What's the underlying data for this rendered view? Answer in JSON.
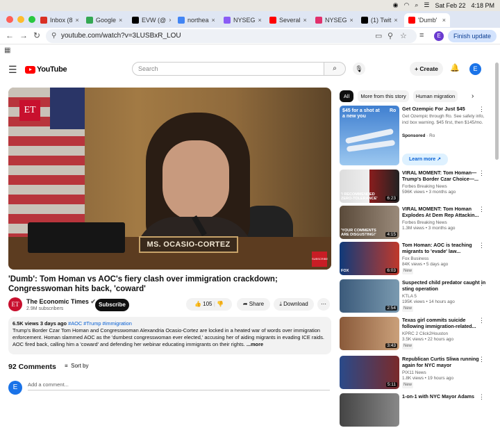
{
  "os": {
    "date": "Sat Feb 22",
    "time": "4:18 PM"
  },
  "tabs": [
    {
      "label": "Inbox (8",
      "color": "#d93025"
    },
    {
      "label": "Google",
      "color": "#34a853"
    },
    {
      "label": "EVW (@",
      "color": "#000000"
    },
    {
      "label": "northea",
      "color": "#4285f4"
    },
    {
      "label": "NYSEG",
      "color": "#8a5cf5"
    },
    {
      "label": "Several",
      "color": "#ff0000"
    },
    {
      "label": "NYSEG",
      "color": "#e1306c"
    },
    {
      "label": "(1) Twit",
      "color": "#000000"
    },
    {
      "label": "'Dumb'",
      "color": "#ff0000"
    }
  ],
  "browser": {
    "url": "youtube.com/watch?v=3LUSBxR_LOU",
    "profile_initial": "E",
    "finish_update": "Finish update"
  },
  "yt": {
    "logo": "YouTube",
    "search_placeholder": "Search",
    "create": "Create",
    "user_initial": "E"
  },
  "video": {
    "nameplate": "MS. OCASIO-CORTEZ",
    "et_logo": "ET",
    "subscribe_badge": "SUBSCRIBE",
    "title": "'Dumb': Tom Homan vs AOC's fiery clash over immigration crackdown; Congresswoman hits back, 'coward'",
    "channel": "The Economic Times",
    "channel_initial": "ET",
    "subscribers": "2.9M subscribers",
    "subscribe": "Subscribe",
    "likes": "105",
    "share": "Share",
    "download": "Download",
    "views_date": "6.5K views  3 days ago",
    "tags": "#AOC #Trump #immigration",
    "description": "Trump's Border Czar Tom Homan and Congresswoman Alexandria Ocasio-Cortez are locked in a heated war of words over immigration enforcement. Homan slammed AOC as the 'dumbest congresswoman ever elected,' accusing her of aiding migrants in evading ICE raids. AOC fired back, calling him a 'coward' and defending her webinar educating immigrants on their rights.",
    "more": "...more"
  },
  "comments": {
    "count": "92 Comments",
    "sort": "Sort by",
    "placeholder": "Add a comment...",
    "user_initial": "E"
  },
  "chips": [
    "All",
    "More from this story",
    "Human migration"
  ],
  "ad": {
    "thumb_text": "$45 for a shot at a new you",
    "title": "Get Ozempic For Just $45",
    "body": "Get Ozempic through Ro. See safety info, incl box warning. $45 first, then $145/mo.",
    "sponsored": "Sponsored",
    "advertiser": "Ro",
    "cta": "Learn more"
  },
  "recs": [
    {
      "title": "VIRAL MOMENT: Tom Homan—Trump's Border Czar Choice—...",
      "channel": "Forbes Breaking News",
      "meta": "596K views • 3 months ago",
      "duration": "6:23",
      "thumb_text": "'I RECOMMENDED ZERO-TOLERANCE'",
      "new": ""
    },
    {
      "title": "VIRAL MOMENT: Tom Homan Explodes At Dem Rep Attackin...",
      "channel": "Forbes Breaking News",
      "meta": "1.3M views • 3 months ago",
      "duration": "4:15",
      "thumb_text": "'YOUR COMMENTS ARE DISGUSTING!'",
      "new": ""
    },
    {
      "title": "Tom Homan: AOC is teaching migrants to 'evade' law...",
      "channel": "Fox Business",
      "meta": "84K views • 5 days ago",
      "duration": "6:03",
      "thumb_text": "FOX",
      "new": "New"
    },
    {
      "title": "Suspected child predator caught in sting operation",
      "channel": "KTLA 5",
      "meta": "195K views • 14 hours ago",
      "duration": "2:54",
      "thumb_text": "",
      "new": "New"
    },
    {
      "title": "Texas girl commits suicide following immigration-related...",
      "channel": "KPRC 2 Click2Houston",
      "meta": "3.5K views • 22 hours ago",
      "duration": "3:43",
      "thumb_text": "",
      "new": "New"
    },
    {
      "title": "Republican Curtis Sliwa running again for NYC mayor",
      "channel": "PIX11 News",
      "meta": "1.8K views • 19 hours ago",
      "duration": "5:11",
      "thumb_text": "",
      "new": "New"
    },
    {
      "title": "1-on-1 with NYC Mayor Adams",
      "channel": "",
      "meta": "",
      "duration": "",
      "thumb_text": "",
      "new": ""
    }
  ]
}
